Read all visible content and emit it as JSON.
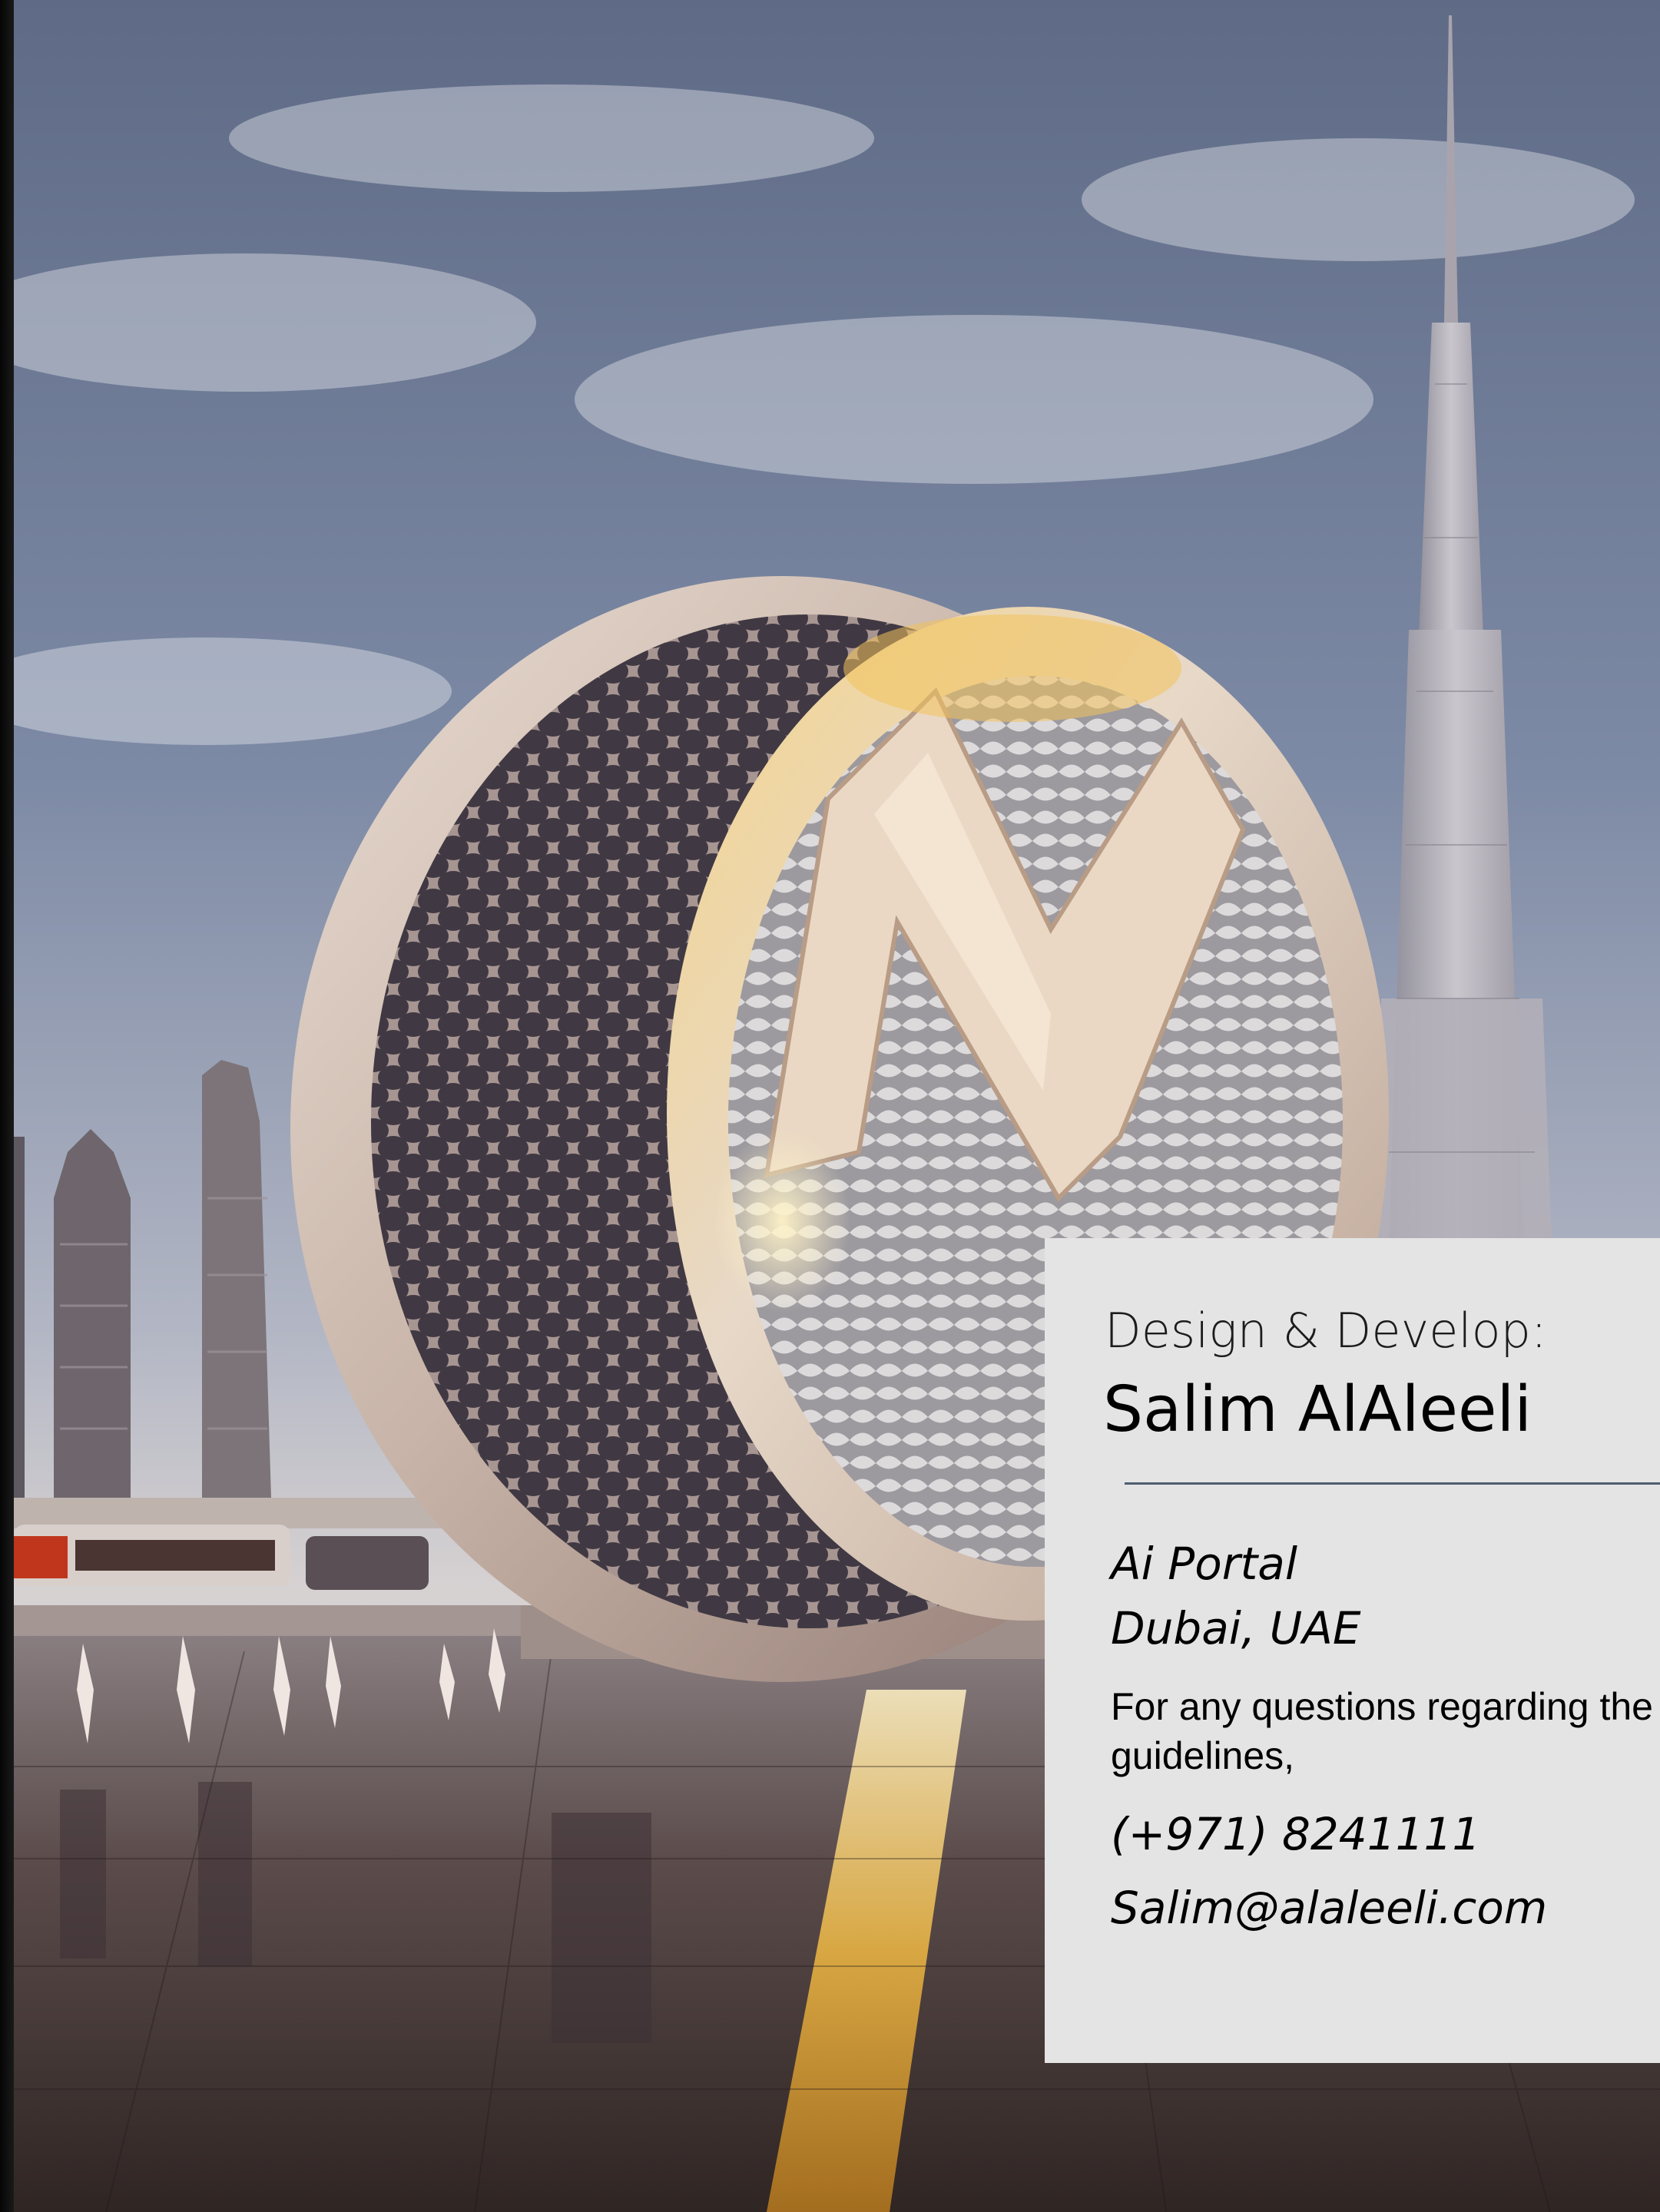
{
  "card": {
    "credit_label": "Design & Develop:",
    "credit_name": "Salim AlAleeli",
    "organization": "Ai Portal",
    "location": "Dubai, UAE",
    "contact_note": "For any questions regarding the and guidelines,",
    "phone": "(+971) 8241111",
    "email": "Salim@alaleeli.com"
  },
  "photo": {
    "subject": "sculptural ring building with lattice facade and large monogram in front of a Dubai skyline"
  },
  "colors": {
    "card_background": "#e4e4e4",
    "divider": "#4f5d6e",
    "text": "#000000",
    "sky": "#6f7c98",
    "gold_accent": "#e0a93a"
  }
}
